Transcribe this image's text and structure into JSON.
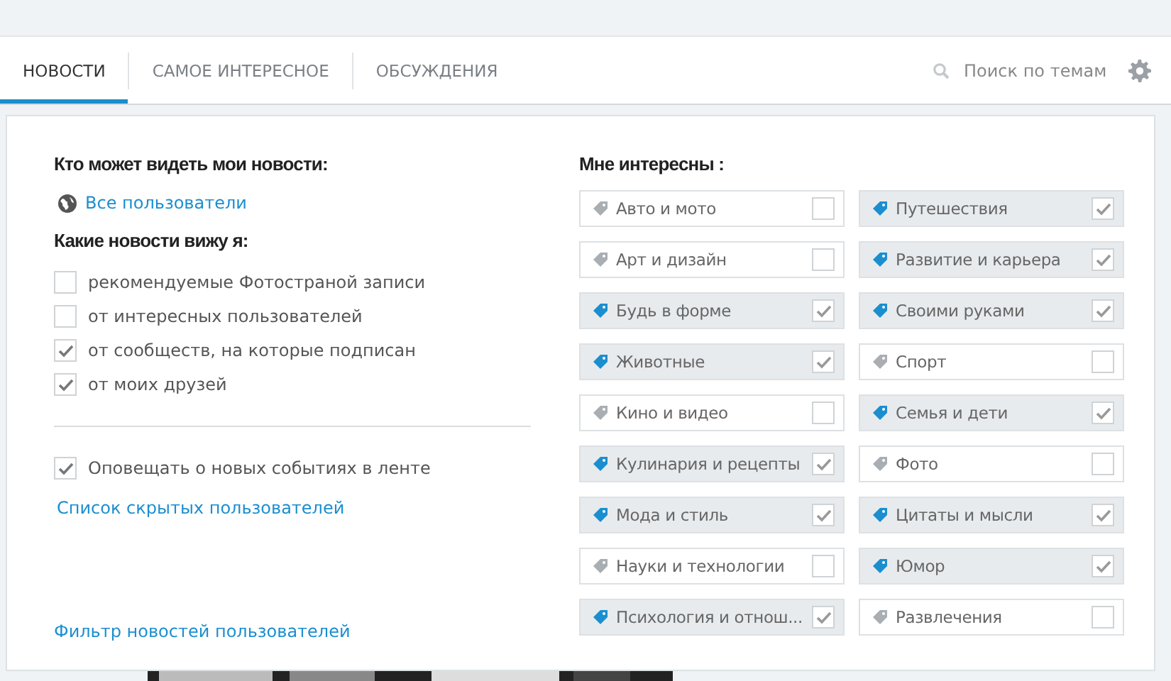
{
  "tabs": [
    {
      "label": "НОВОСТИ",
      "selected": true
    },
    {
      "label": "САМОЕ ИНТЕРЕСНОЕ",
      "selected": false
    },
    {
      "label": "ОБСУЖДЕНИЯ",
      "selected": false
    }
  ],
  "search": {
    "placeholder": "Поиск по темам"
  },
  "visibility": {
    "title": "Кто может видеть мои новости:",
    "value": "Все пользователи"
  },
  "feed": {
    "title": "Какие новости вижу я:",
    "options": [
      {
        "label": "рекомендуемые Фотостраной записи",
        "checked": false
      },
      {
        "label": "от интересных пользователей",
        "checked": false
      },
      {
        "label": "от сообществ, на которые подписан",
        "checked": true
      },
      {
        "label": "от моих друзей",
        "checked": true
      }
    ]
  },
  "notify": {
    "label": "Оповещать о новых событиях в ленте",
    "checked": true
  },
  "hidden_link": "Список скрытых пользователей",
  "filter_link": "Фильтр новостей пользователей",
  "interests": {
    "title": "Мне интересны :",
    "topics": [
      {
        "label": "Авто и мото",
        "checked": false
      },
      {
        "label": "Путешествия",
        "checked": true
      },
      {
        "label": "Арт и дизайн",
        "checked": false
      },
      {
        "label": "Развитие и карьера",
        "checked": true
      },
      {
        "label": "Будь в форме",
        "checked": true
      },
      {
        "label": "Своими руками",
        "checked": true
      },
      {
        "label": "Животные",
        "checked": true
      },
      {
        "label": "Спорт",
        "checked": false
      },
      {
        "label": "Кино и видео",
        "checked": false
      },
      {
        "label": "Семья и дети",
        "checked": true
      },
      {
        "label": "Кулинария и рецепты",
        "checked": true
      },
      {
        "label": "Фото",
        "checked": false
      },
      {
        "label": "Мода и стиль",
        "checked": true
      },
      {
        "label": "Цитаты и мысли",
        "checked": true
      },
      {
        "label": "Науки и технологии",
        "checked": false
      },
      {
        "label": "Юмор",
        "checked": true
      },
      {
        "label": "Психология и отнош...",
        "checked": true
      },
      {
        "label": "Развлечения",
        "checked": false
      }
    ]
  }
}
